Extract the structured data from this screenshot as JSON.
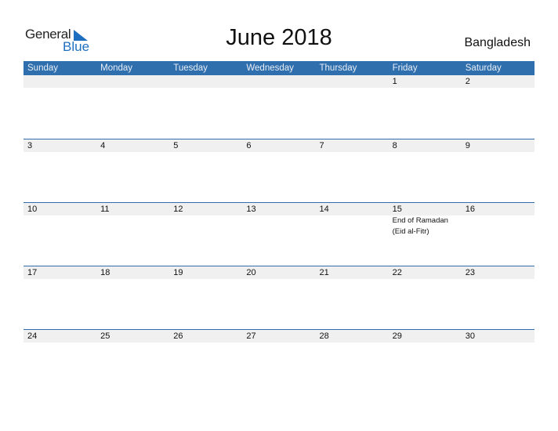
{
  "logo": {
    "line1": "General",
    "line2": "Blue",
    "icon": "triangle-flag-icon"
  },
  "title": "June 2018",
  "country": "Bangladesh",
  "colors": {
    "header_bg": "#2f6fae",
    "strip_bg": "#f0f0f0",
    "brand_blue": "#1f6fc0"
  },
  "weekdays": [
    "Sunday",
    "Monday",
    "Tuesday",
    "Wednesday",
    "Thursday",
    "Friday",
    "Saturday"
  ],
  "weeks": [
    {
      "days": [
        "",
        "",
        "",
        "",
        "",
        "1",
        "2"
      ],
      "events": [
        "",
        "",
        "",
        "",
        "",
        "",
        ""
      ]
    },
    {
      "days": [
        "3",
        "4",
        "5",
        "6",
        "7",
        "8",
        "9"
      ],
      "events": [
        "",
        "",
        "",
        "",
        "",
        "",
        ""
      ]
    },
    {
      "days": [
        "10",
        "11",
        "12",
        "13",
        "14",
        "15",
        "16"
      ],
      "events": [
        "",
        "",
        "",
        "",
        "",
        "End of Ramadan (Eid al-Fitr)",
        ""
      ]
    },
    {
      "days": [
        "17",
        "18",
        "19",
        "20",
        "21",
        "22",
        "23"
      ],
      "events": [
        "",
        "",
        "",
        "",
        "",
        "",
        ""
      ]
    },
    {
      "days": [
        "24",
        "25",
        "26",
        "27",
        "28",
        "29",
        "30"
      ],
      "events": [
        "",
        "",
        "",
        "",
        "",
        "",
        ""
      ]
    }
  ]
}
